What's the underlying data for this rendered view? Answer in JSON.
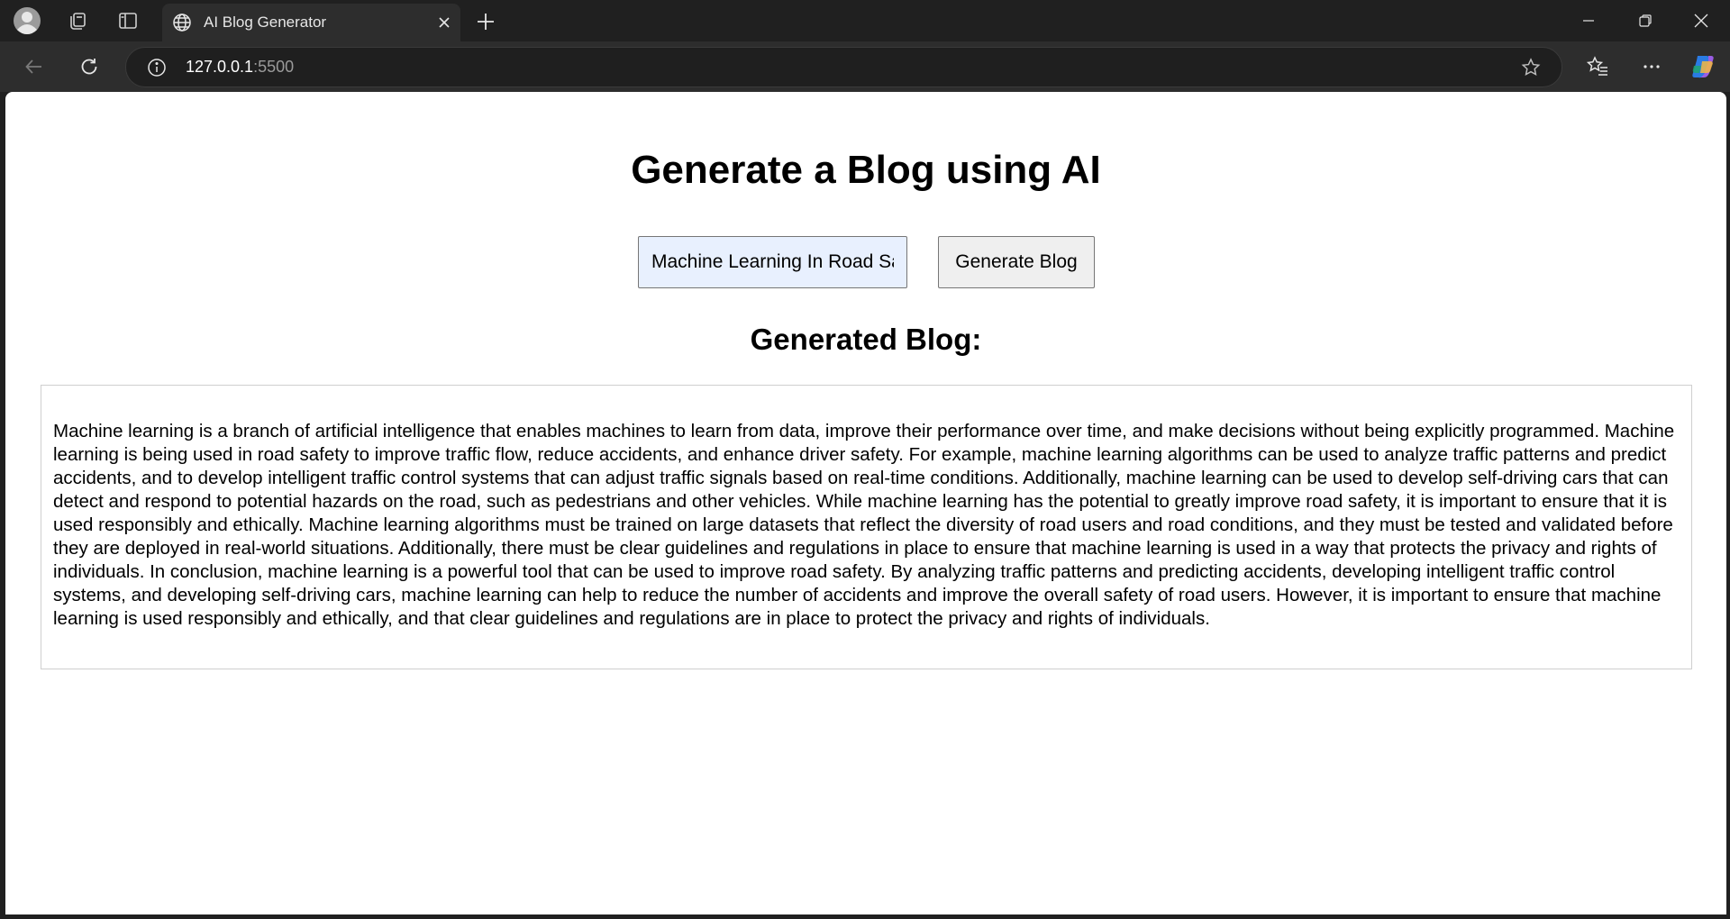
{
  "browser": {
    "tab": {
      "title": "AI Blog Generator"
    },
    "address": {
      "host": "127.0.0.1",
      "port": ":5500"
    }
  },
  "page": {
    "title": "Generate a Blog using AI",
    "topic_input": {
      "value": "Machine Learning In Road Safety",
      "placeholder": ""
    },
    "generate_button": "Generate Blog",
    "generated_heading": "Generated Blog:",
    "blog_text": "Machine learning is a branch of artificial intelligence that enables machines to learn from data, improve their performance over time, and make decisions without being explicitly programmed. Machine learning is being used in road safety to improve traffic flow, reduce accidents, and enhance driver safety. For example, machine learning algorithms can be used to analyze traffic patterns and predict accidents, and to develop intelligent traffic control systems that can adjust traffic signals based on real-time conditions. Additionally, machine learning can be used to develop self-driving cars that can detect and respond to potential hazards on the road, such as pedestrians and other vehicles. While machine learning has the potential to greatly improve road safety, it is important to ensure that it is used responsibly and ethically. Machine learning algorithms must be trained on large datasets that reflect the diversity of road users and road conditions, and they must be tested and validated before they are deployed in real-world situations. Additionally, there must be clear guidelines and regulations in place to ensure that machine learning is used in a way that protects the privacy and rights of individuals. In conclusion, machine learning is a powerful tool that can be used to improve road safety. By analyzing traffic patterns and predicting accidents, developing intelligent traffic control systems, and developing self-driving cars, machine learning can help to reduce the number of accidents and improve the overall safety of road users. However, it is important to ensure that machine learning is used responsibly and ethically, and that clear guidelines and regulations are in place to protect the privacy and rights of individuals."
  },
  "colors": {
    "chrome_dark": "#202020",
    "toolbar": "#2d2d2d",
    "input_autofill_bg": "#e8f0fe",
    "button_bg": "#efefef"
  },
  "icons": [
    "profile-avatar-icon",
    "workspaces-icon",
    "vertical-tabs-icon",
    "globe-icon",
    "close-icon",
    "plus-icon",
    "minimize-icon",
    "restore-icon",
    "window-close-icon",
    "back-arrow-icon",
    "refresh-icon",
    "info-icon",
    "favorite-star-icon",
    "favorites-icon",
    "more-icon",
    "copilot-icon"
  ]
}
